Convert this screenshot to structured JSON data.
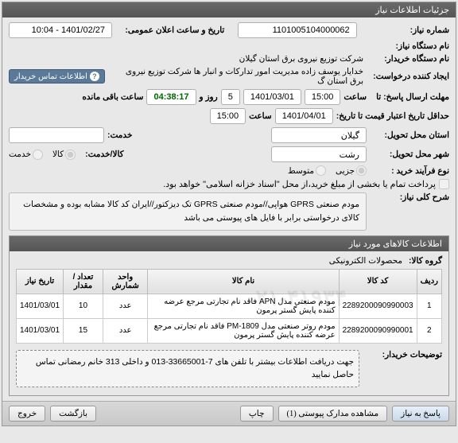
{
  "header": {
    "title": "جزئیات اطلاعات نیاز"
  },
  "need": {
    "number_label": "شماره نیاز:",
    "number": "1101005104000062",
    "announce_label": "تاریخ و ساعت اعلان عمومی:",
    "announce": "1401/02/27 - 10:04",
    "device_label": "نام دستگاه نیاز:",
    "buyer_label": "نام دستگاه خریدار:",
    "buyer": "شرکت توزیع نیروی برق استان گیلان",
    "requester_label": "ایجاد کننده درخواست:",
    "requester": "خدایار یوسف زاده مدیریت امور تدارکات و انبار ها شرکت توزیع نیروی برق استان گ",
    "contact_btn": "اطلاعات تماس خریدار",
    "response_time_label": "مهلت ارسال پاسخ: تا",
    "response_hour_label": "ساعت",
    "response_date": "1401/03/01",
    "response_hour": "15:00",
    "day_label": "روز و",
    "days_left": "5",
    "remain_label": "ساعت باقی مانده",
    "remain_time": "04:38:17",
    "deadline_label": "حداقل تاریخ اعتبار قیمت تا تاریخ:",
    "deadline_date": "1401/04/01",
    "deadline_hour_label": "ساعت",
    "deadline_hour": "15:00",
    "province_label": "استان محل تحویل:",
    "province": "گیلان",
    "service_label": "خدمت:",
    "city_label": "شهر محل تحویل:",
    "city": "رشت",
    "item_type_label": "کالا/خدمت:",
    "radio_kala": "کالا",
    "radio_khidmat": "خدمت",
    "process_label": "نوع فرآیند خرید :",
    "radio_partial": "جزیی",
    "radio_medium": "متوسط",
    "payment_note": "پرداخت تمام یا بخشی از مبلغ خرید،از محل \"اسناد خزانه اسلامی\" خواهد بود.",
    "desc_label": "شرح کلی نیاز:",
    "desc_text": "مودم صنعتی GPRS هواپی//مودم صنعتی GPRS تک دیزکتور//ایران کد کالا مشابه بوده و مشخصات کالای درخواستی برابر با فایل های پیوستی می باشد"
  },
  "items": {
    "section_title": "اطلاعات کالاهای مورد نیاز",
    "group_label": "گروه کالا:",
    "group_value": "محصولات الکترونیکی",
    "columns": [
      "ردیف",
      "کد کالا",
      "نام کالا",
      "واحد شمارش",
      "تعداد / مقدار",
      "تاریخ نیاز"
    ],
    "rows": [
      {
        "idx": "1",
        "code": "2289200090990003",
        "name": "مودم صنعتی مدل APN فاقد نام تجارتی مرجع عرضه کننده پایش گستر پرمون",
        "unit": "عدد",
        "qty": "10",
        "date": "1401/03/01"
      },
      {
        "idx": "2",
        "code": "2289200090990001",
        "name": "مودم روتر صنعتی مدل PM-1809 فاقد نام تجارتی مرجع عرضه کننده پایش گستر پرمون",
        "unit": "عدد",
        "qty": "15",
        "date": "1401/03/01"
      }
    ],
    "watermark": "۰۲۱-۴۱۹۳۴"
  },
  "buyer_notes": {
    "label": "توضیحات خریدار:",
    "text": "جهت دریافت اطلاعات بیشتر با تلفن های 7-33665001-013 و داخلی 313 خانم رمضانی تماس حاصل نمایید"
  },
  "footer": {
    "respond": "پاسخ به نیاز",
    "attachments": "مشاهده مدارک پیوستی (1)",
    "print": "چاپ",
    "back": "بازگشت",
    "exit": "خروج"
  }
}
